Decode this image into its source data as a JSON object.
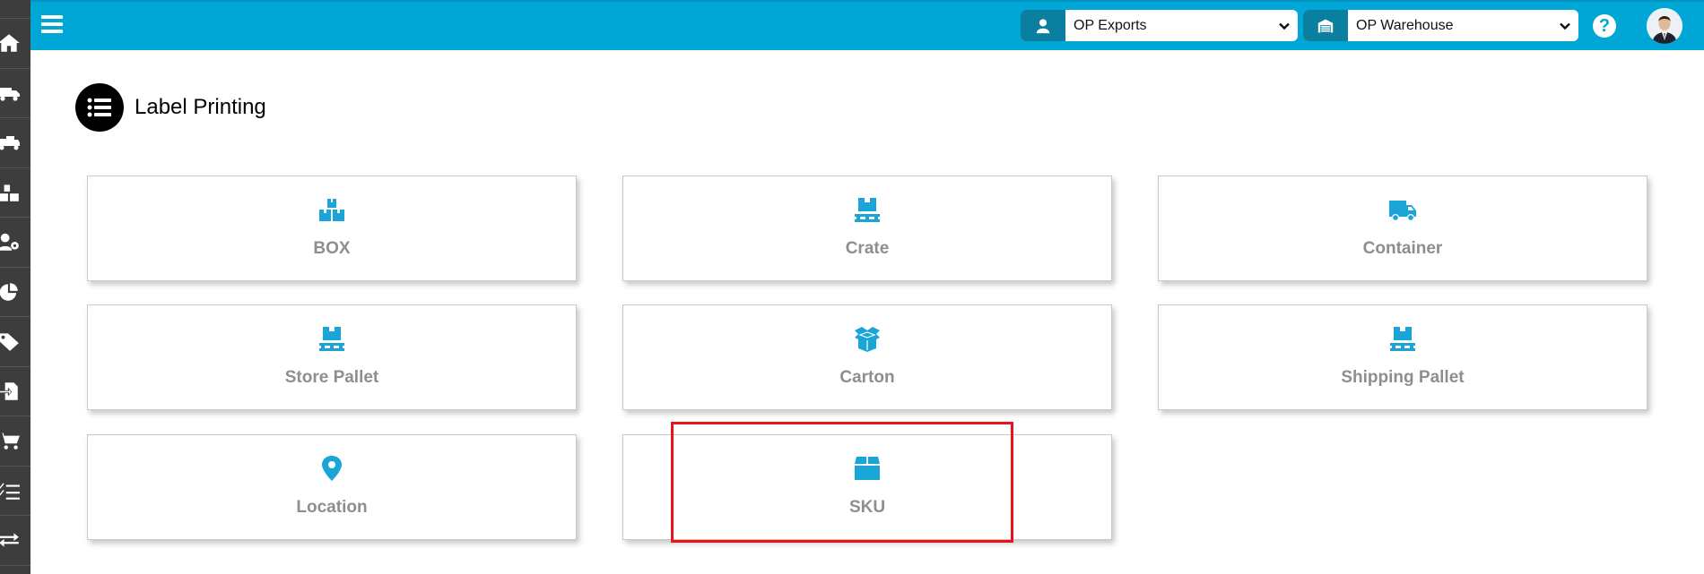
{
  "topbar": {
    "company_select": {
      "value": "OP Exports",
      "icon": "user-icon"
    },
    "warehouse_select": {
      "value": "OP Warehouse",
      "icon": "warehouse-icon"
    },
    "help_label": "?"
  },
  "page": {
    "title": "Label Printing",
    "icon": "list-icon"
  },
  "rail": [
    "home-icon",
    "truck-icon",
    "truck-loaded-icon",
    "boxes-icon",
    "user-gear-icon",
    "pie-chart-icon",
    "tag-icon",
    "file-import-icon",
    "cart-icon",
    "checklist-icon",
    "exchange-icon"
  ],
  "cards": [
    {
      "label": "BOX",
      "icon": "boxes-icon"
    },
    {
      "label": "Crate",
      "icon": "pallet-icon"
    },
    {
      "label": "Container",
      "icon": "truck-icon"
    },
    {
      "label": "Store Pallet",
      "icon": "pallet-icon"
    },
    {
      "label": "Carton",
      "icon": "open-box-icon"
    },
    {
      "label": "Shipping Pallet",
      "icon": "pallet-icon"
    },
    {
      "label": "Location",
      "icon": "map-marker-icon"
    },
    {
      "label": "SKU",
      "icon": "box-icon"
    }
  ],
  "colors": {
    "accent": "#00a7d6",
    "rail": "#3d3d3d",
    "card_icon": "#1aa5d8",
    "highlight": "#e8141a"
  }
}
